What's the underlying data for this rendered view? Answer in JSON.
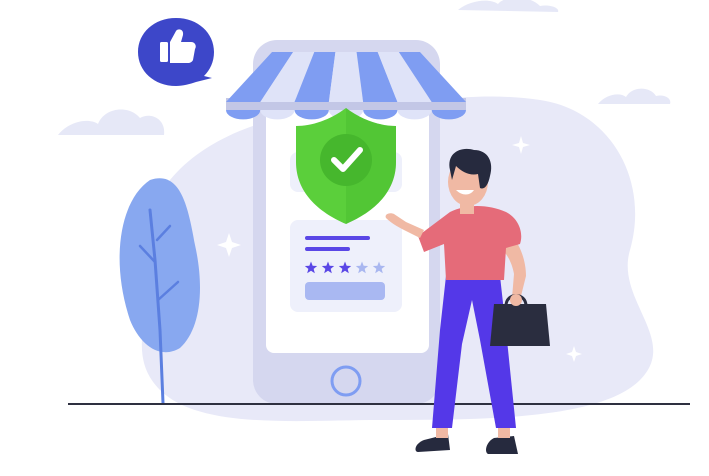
{
  "colors": {
    "blob": "#e8e9f8",
    "cloud": "#e6e8f7",
    "phone_body": "#d5d7ef",
    "phone_screen": "#ffffff",
    "awning_blue": "#7f9df2",
    "awning_light": "#dfe3f8",
    "awning_rail": "#c3c7e6",
    "shield_green": "#5bcf3b",
    "shield_dark_green": "#41b52a",
    "check_green": "#46b72d",
    "thumb_bubble": "#3d47c9",
    "card_bg": "#eef0fb",
    "line_purple": "#5a47e6",
    "star_purple": "#5a47e6",
    "star_light": "#a9b7f0",
    "button_light": "#a9b8f2",
    "plant_blue": "#88a8f0",
    "shirt": "#e56b79",
    "pants": "#5438e8",
    "skin": "#f0b9a4",
    "hair": "#262a3e",
    "bag": "#2a2d3f",
    "ground": "#2e3040"
  },
  "icons": {
    "like": "thumbs-up-icon",
    "shield": "shield-check-icon",
    "home_button": "home-button-icon",
    "sparkle": "sparkle-icon"
  },
  "rating": {
    "filled": 3,
    "total": 5
  }
}
